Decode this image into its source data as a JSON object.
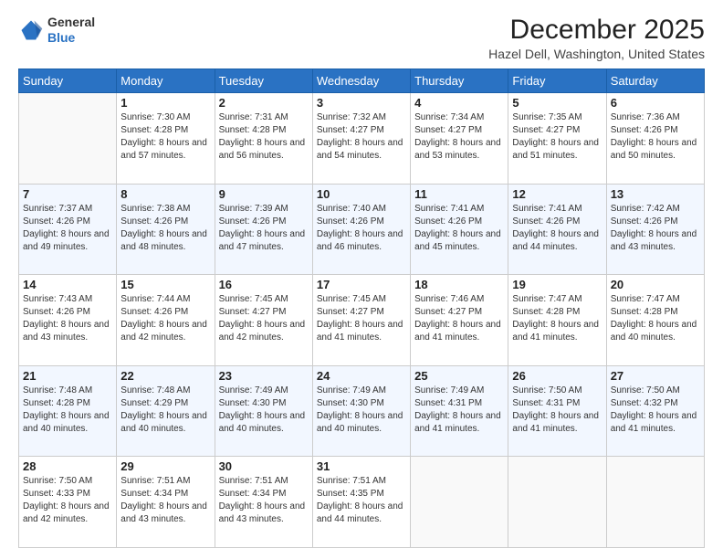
{
  "header": {
    "logo": {
      "line1": "General",
      "line2": "Blue"
    },
    "title": "December 2025",
    "subtitle": "Hazel Dell, Washington, United States"
  },
  "weekdays": [
    "Sunday",
    "Monday",
    "Tuesday",
    "Wednesday",
    "Thursday",
    "Friday",
    "Saturday"
  ],
  "weeks": [
    [
      {
        "day": "",
        "sunrise": "",
        "sunset": "",
        "daylight": "",
        "empty": true
      },
      {
        "day": "1",
        "sunrise": "Sunrise: 7:30 AM",
        "sunset": "Sunset: 4:28 PM",
        "daylight": "Daylight: 8 hours and 57 minutes."
      },
      {
        "day": "2",
        "sunrise": "Sunrise: 7:31 AM",
        "sunset": "Sunset: 4:28 PM",
        "daylight": "Daylight: 8 hours and 56 minutes."
      },
      {
        "day": "3",
        "sunrise": "Sunrise: 7:32 AM",
        "sunset": "Sunset: 4:27 PM",
        "daylight": "Daylight: 8 hours and 54 minutes."
      },
      {
        "day": "4",
        "sunrise": "Sunrise: 7:34 AM",
        "sunset": "Sunset: 4:27 PM",
        "daylight": "Daylight: 8 hours and 53 minutes."
      },
      {
        "day": "5",
        "sunrise": "Sunrise: 7:35 AM",
        "sunset": "Sunset: 4:27 PM",
        "daylight": "Daylight: 8 hours and 51 minutes."
      },
      {
        "day": "6",
        "sunrise": "Sunrise: 7:36 AM",
        "sunset": "Sunset: 4:26 PM",
        "daylight": "Daylight: 8 hours and 50 minutes."
      }
    ],
    [
      {
        "day": "7",
        "sunrise": "Sunrise: 7:37 AM",
        "sunset": "Sunset: 4:26 PM",
        "daylight": "Daylight: 8 hours and 49 minutes."
      },
      {
        "day": "8",
        "sunrise": "Sunrise: 7:38 AM",
        "sunset": "Sunset: 4:26 PM",
        "daylight": "Daylight: 8 hours and 48 minutes."
      },
      {
        "day": "9",
        "sunrise": "Sunrise: 7:39 AM",
        "sunset": "Sunset: 4:26 PM",
        "daylight": "Daylight: 8 hours and 47 minutes."
      },
      {
        "day": "10",
        "sunrise": "Sunrise: 7:40 AM",
        "sunset": "Sunset: 4:26 PM",
        "daylight": "Daylight: 8 hours and 46 minutes."
      },
      {
        "day": "11",
        "sunrise": "Sunrise: 7:41 AM",
        "sunset": "Sunset: 4:26 PM",
        "daylight": "Daylight: 8 hours and 45 minutes."
      },
      {
        "day": "12",
        "sunrise": "Sunrise: 7:41 AM",
        "sunset": "Sunset: 4:26 PM",
        "daylight": "Daylight: 8 hours and 44 minutes."
      },
      {
        "day": "13",
        "sunrise": "Sunrise: 7:42 AM",
        "sunset": "Sunset: 4:26 PM",
        "daylight": "Daylight: 8 hours and 43 minutes."
      }
    ],
    [
      {
        "day": "14",
        "sunrise": "Sunrise: 7:43 AM",
        "sunset": "Sunset: 4:26 PM",
        "daylight": "Daylight: 8 hours and 43 minutes."
      },
      {
        "day": "15",
        "sunrise": "Sunrise: 7:44 AM",
        "sunset": "Sunset: 4:26 PM",
        "daylight": "Daylight: 8 hours and 42 minutes."
      },
      {
        "day": "16",
        "sunrise": "Sunrise: 7:45 AM",
        "sunset": "Sunset: 4:27 PM",
        "daylight": "Daylight: 8 hours and 42 minutes."
      },
      {
        "day": "17",
        "sunrise": "Sunrise: 7:45 AM",
        "sunset": "Sunset: 4:27 PM",
        "daylight": "Daylight: 8 hours and 41 minutes."
      },
      {
        "day": "18",
        "sunrise": "Sunrise: 7:46 AM",
        "sunset": "Sunset: 4:27 PM",
        "daylight": "Daylight: 8 hours and 41 minutes."
      },
      {
        "day": "19",
        "sunrise": "Sunrise: 7:47 AM",
        "sunset": "Sunset: 4:28 PM",
        "daylight": "Daylight: 8 hours and 41 minutes."
      },
      {
        "day": "20",
        "sunrise": "Sunrise: 7:47 AM",
        "sunset": "Sunset: 4:28 PM",
        "daylight": "Daylight: 8 hours and 40 minutes."
      }
    ],
    [
      {
        "day": "21",
        "sunrise": "Sunrise: 7:48 AM",
        "sunset": "Sunset: 4:28 PM",
        "daylight": "Daylight: 8 hours and 40 minutes."
      },
      {
        "day": "22",
        "sunrise": "Sunrise: 7:48 AM",
        "sunset": "Sunset: 4:29 PM",
        "daylight": "Daylight: 8 hours and 40 minutes."
      },
      {
        "day": "23",
        "sunrise": "Sunrise: 7:49 AM",
        "sunset": "Sunset: 4:30 PM",
        "daylight": "Daylight: 8 hours and 40 minutes."
      },
      {
        "day": "24",
        "sunrise": "Sunrise: 7:49 AM",
        "sunset": "Sunset: 4:30 PM",
        "daylight": "Daylight: 8 hours and 40 minutes."
      },
      {
        "day": "25",
        "sunrise": "Sunrise: 7:49 AM",
        "sunset": "Sunset: 4:31 PM",
        "daylight": "Daylight: 8 hours and 41 minutes."
      },
      {
        "day": "26",
        "sunrise": "Sunrise: 7:50 AM",
        "sunset": "Sunset: 4:31 PM",
        "daylight": "Daylight: 8 hours and 41 minutes."
      },
      {
        "day": "27",
        "sunrise": "Sunrise: 7:50 AM",
        "sunset": "Sunset: 4:32 PM",
        "daylight": "Daylight: 8 hours and 41 minutes."
      }
    ],
    [
      {
        "day": "28",
        "sunrise": "Sunrise: 7:50 AM",
        "sunset": "Sunset: 4:33 PM",
        "daylight": "Daylight: 8 hours and 42 minutes."
      },
      {
        "day": "29",
        "sunrise": "Sunrise: 7:51 AM",
        "sunset": "Sunset: 4:34 PM",
        "daylight": "Daylight: 8 hours and 43 minutes."
      },
      {
        "day": "30",
        "sunrise": "Sunrise: 7:51 AM",
        "sunset": "Sunset: 4:34 PM",
        "daylight": "Daylight: 8 hours and 43 minutes."
      },
      {
        "day": "31",
        "sunrise": "Sunrise: 7:51 AM",
        "sunset": "Sunset: 4:35 PM",
        "daylight": "Daylight: 8 hours and 44 minutes."
      },
      {
        "day": "",
        "sunrise": "",
        "sunset": "",
        "daylight": "",
        "empty": true
      },
      {
        "day": "",
        "sunrise": "",
        "sunset": "",
        "daylight": "",
        "empty": true
      },
      {
        "day": "",
        "sunrise": "",
        "sunset": "",
        "daylight": "",
        "empty": true
      }
    ]
  ]
}
